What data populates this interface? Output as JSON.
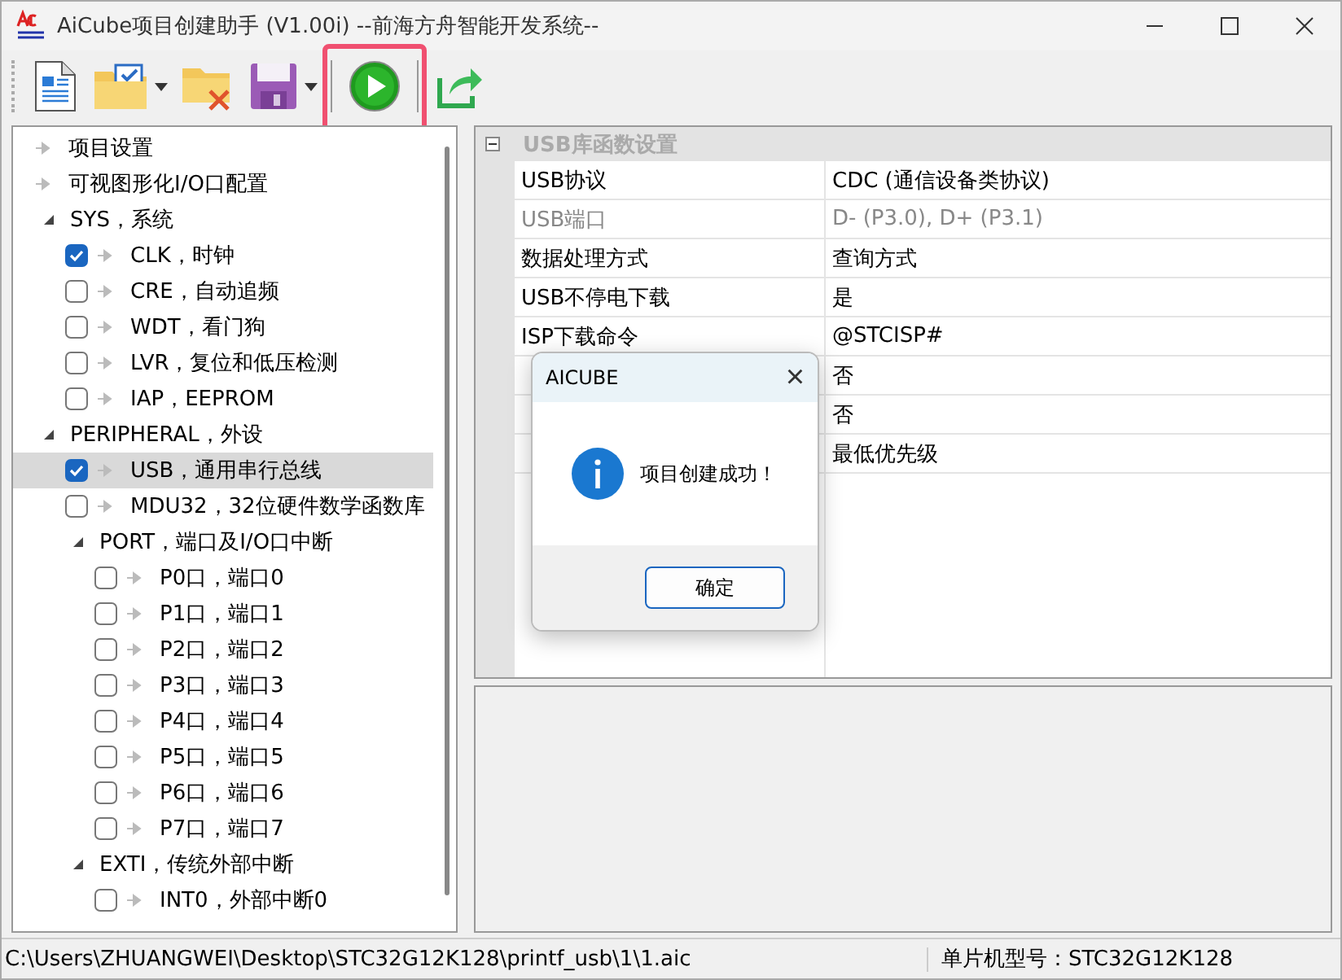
{
  "window": {
    "title": "AiCube项目创建助手 (V1.00i) --前海方舟智能开发系统--"
  },
  "toolbar": [
    {
      "kind": "new",
      "dropdown": false,
      "highlighted": false
    },
    {
      "kind": "open",
      "dropdown": true,
      "highlighted": false
    },
    {
      "kind": "close",
      "dropdown": false,
      "highlighted": false
    },
    {
      "kind": "save",
      "dropdown": true,
      "highlighted": false
    },
    {
      "kind": "run",
      "dropdown": false,
      "highlighted": true
    },
    {
      "kind": "export",
      "dropdown": false,
      "highlighted": false
    }
  ],
  "tree": [
    {
      "kind": "link",
      "label": "项目设置",
      "selected": false
    },
    {
      "kind": "link",
      "label": "可视图形化I/O口配置",
      "selected": false
    },
    {
      "kind": "group",
      "label": "SYS，系统",
      "expanded": true,
      "selected": false,
      "children": [
        {
          "kind": "check",
          "label": "CLK，时钟",
          "checked": true,
          "selected": false
        },
        {
          "kind": "check",
          "label": "CRE，自动追频",
          "checked": false,
          "selected": false
        },
        {
          "kind": "check",
          "label": "WDT，看门狗",
          "checked": false,
          "selected": false
        },
        {
          "kind": "check",
          "label": "LVR，复位和低压检测",
          "checked": false,
          "selected": false
        },
        {
          "kind": "check",
          "label": "IAP，EEPROM",
          "checked": false,
          "selected": false
        }
      ]
    },
    {
      "kind": "group",
      "label": "PERIPHERAL，外设",
      "expanded": true,
      "selected": false,
      "children": [
        {
          "kind": "check",
          "label": "USB，通用串行总线",
          "checked": true,
          "selected": true
        },
        {
          "kind": "check",
          "label": "MDU32，32位硬件数学函数库",
          "checked": false,
          "selected": false
        },
        {
          "kind": "group",
          "label": "PORT，端口及I/O口中断",
          "expanded": true,
          "selected": false,
          "children": [
            {
              "kind": "check",
              "label": "P0口，端口0",
              "checked": false,
              "selected": false
            },
            {
              "kind": "check",
              "label": "P1口，端口1",
              "checked": false,
              "selected": false
            },
            {
              "kind": "check",
              "label": "P2口，端口2",
              "checked": false,
              "selected": false
            },
            {
              "kind": "check",
              "label": "P3口，端口3",
              "checked": false,
              "selected": false
            },
            {
              "kind": "check",
              "label": "P4口，端口4",
              "checked": false,
              "selected": false
            },
            {
              "kind": "check",
              "label": "P5口，端口5",
              "checked": false,
              "selected": false
            },
            {
              "kind": "check",
              "label": "P6口，端口6",
              "checked": false,
              "selected": false
            },
            {
              "kind": "check",
              "label": "P7口，端口7",
              "checked": false,
              "selected": false
            }
          ]
        },
        {
          "kind": "group",
          "label": "EXTI，传统外部中断",
          "expanded": true,
          "selected": false,
          "children": [
            {
              "kind": "check",
              "label": "INT0，外部中断0",
              "checked": false,
              "selected": false
            }
          ]
        }
      ]
    }
  ],
  "properties": {
    "section": "USB库函数设置",
    "expanded": true,
    "rows": [
      {
        "key": "USB协议",
        "value": "CDC (通信设备类协议)",
        "disabled": false
      },
      {
        "key": "USB端口",
        "value": "D- (P3.0), D+ (P3.1)",
        "disabled": true
      },
      {
        "key": "数据处理方式",
        "value": "查询方式",
        "disabled": false
      },
      {
        "key": "USB不停电下载",
        "value": "是",
        "disabled": false
      },
      {
        "key": "ISP下载命令",
        "value": "@STCISP#",
        "disabled": false
      },
      {
        "value": "否",
        "disabled": false
      },
      {
        "value": "否",
        "disabled": false
      },
      {
        "value": "最低优先级",
        "disabled": false
      }
    ]
  },
  "dialog": {
    "title": "AICUBE",
    "close": "×",
    "message": "项目创建成功！",
    "button": "确定"
  },
  "status_bar": {
    "path": "C:\\Users\\ZHUANGWEI\\Desktop\\STC32G12K128\\printf_usb\\1\\1.aic",
    "chip": "单片机型号：STC32G12K128"
  }
}
